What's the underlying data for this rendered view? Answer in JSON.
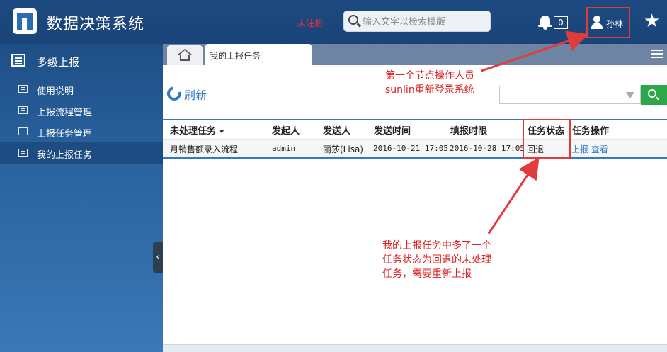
{
  "header": {
    "app_title": "数据决策系统",
    "unregistered_label": "未注册",
    "search_placeholder": "输入文字以检索模版",
    "notification_count": "0",
    "user_name": "孙林"
  },
  "sidebar": {
    "section_title": "多级上报",
    "items": [
      {
        "label": "使用说明"
      },
      {
        "label": "上报流程管理"
      },
      {
        "label": "上报任务管理"
      },
      {
        "label": "我的上报任务",
        "active": true
      }
    ]
  },
  "tabs": {
    "active_tab": "我的上报任务"
  },
  "toolbar": {
    "refresh_label": "刷新",
    "filter_value": ""
  },
  "table": {
    "columns": [
      "未处理任务",
      "发起人",
      "发送人",
      "发送时间",
      "填报时限",
      "任务状态",
      "任务操作"
    ],
    "rows": [
      {
        "task": "月销售额录入流程",
        "initiator": "admin",
        "sender": "丽莎(Lisa)",
        "send_time": "2016-10-21 17:05",
        "deadline": "2016-10-28 17:05",
        "status": "回退",
        "action_report": "上报",
        "action_view": "查看"
      }
    ]
  },
  "annotations": {
    "note1_line1": "第一个节点操作人员",
    "note1_line2": "sunlin重新登录系统",
    "note2_line1": "我的上报任务中多了一个",
    "note2_line2": "任务状态为回退的未处理",
    "note2_line3": "任务，需要重新上报"
  },
  "colors": {
    "header_bg": "#1d4a80",
    "accent_blue": "#2e7bc4",
    "annotation_red": "#e02020",
    "search_button_green": "#2ca74a"
  },
  "icons": [
    "logo-icon",
    "search-icon",
    "bell-icon",
    "user-icon",
    "star-icon",
    "report-icon",
    "doc-icon",
    "collapse-icon",
    "home-icon",
    "menu-icon",
    "refresh-icon",
    "dropdown-arrow-icon"
  ]
}
